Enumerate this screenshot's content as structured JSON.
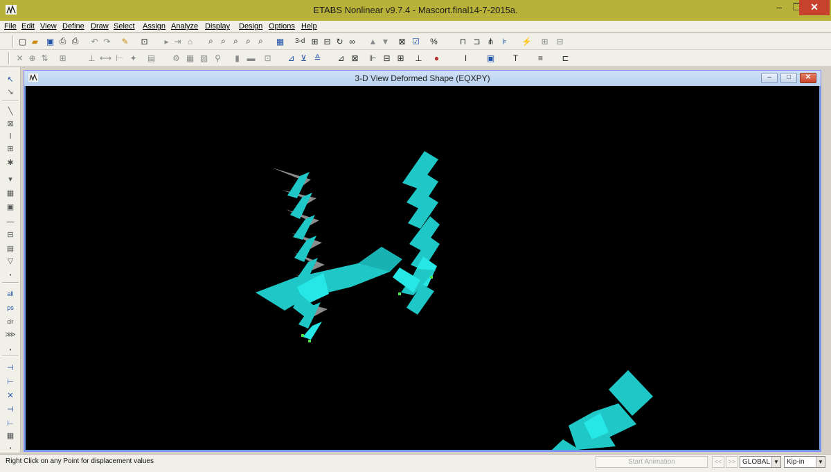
{
  "window": {
    "title": "ETABS Nonlinear v9.7.4 - Mascort.final14-7-2015a.",
    "min_glyph": "–",
    "restore_glyph": "❐",
    "close_glyph": "✕"
  },
  "menu": [
    "File",
    "Edit",
    "View",
    "Define",
    "Draw",
    "Select",
    "Assign",
    "Analyze",
    "Display",
    "Design",
    "Options",
    "Help"
  ],
  "toolbar_row1": {
    "threed_label": "3-d",
    "icons": [
      "new-icon",
      "open-icon",
      "save-icon",
      "print-icon",
      "print-preview-icon",
      "undo-icon",
      "redo-icon",
      "pencil-icon",
      "lock-icon",
      "run-icon",
      "zoom-in-icon",
      "zoom-out-icon",
      "pan-icon",
      "refresh-icon",
      "section-icon",
      "percent-icon",
      "frame-icon",
      "lightning-icon"
    ]
  },
  "toolbar_row2": {
    "icons": [
      "select-icon",
      "move-icon",
      "rotate-icon",
      "mesh-icon",
      "dimension-icon",
      "grid-icon",
      "chart-icon",
      "beam-icon",
      "column-icon",
      "wall-icon",
      "diaphragm-icon"
    ]
  },
  "left_toolbar": {
    "labels": [
      "all",
      "ps",
      "clr"
    ]
  },
  "view": {
    "title": "3-D View  Deformed Shape (EQXPY)",
    "min_glyph": "–",
    "max_glyph": "□",
    "close_glyph": "✕"
  },
  "status": {
    "hint": "Right Click on any Point for displacement values",
    "animation_button": "Start Animation",
    "prev_glyph": "<<",
    "next_glyph": ">>",
    "coord_system": "GLOBAL",
    "units": "Kip-in"
  },
  "colors": {
    "model_fill": "#1fc7c7",
    "model_light": "#26e6e6",
    "deck_grey": "#8c8c8c",
    "joint_marker": "#46e84a",
    "background": "#000000"
  }
}
